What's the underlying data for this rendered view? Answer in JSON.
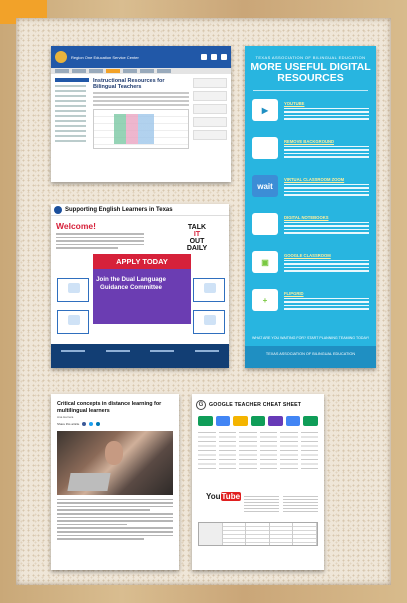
{
  "card_web": {
    "org_name": "Region One Education Service Center",
    "heading": "Instructional Resources for Bilingual Teachers"
  },
  "card_infographic": {
    "kicker": "TEXAS ASSOCIATION OF BILINGUAL EDUCATION",
    "title": "MORE USEFUL DIGITAL RESOURCES",
    "items": [
      {
        "label": "YOUTUBE",
        "icon": "youtube-icon",
        "icon_color": "#ffffff",
        "icon_text": "▶"
      },
      {
        "label": "REMOVE BACKGROUND",
        "icon": "remove-bg-icon",
        "icon_color": "#e9c7c7",
        "icon_text": ""
      },
      {
        "label": "VIRTUAL CLASSROOM ZOOM",
        "icon": "nearpod-icon",
        "icon_color": "#ffffff",
        "icon_text": "wait"
      },
      {
        "label": "DIGITAL NOTEBOOKS",
        "icon": "notebook-icon",
        "icon_color": "#ffffff",
        "icon_text": ""
      },
      {
        "label": "GOOGLE CLASSROOM",
        "icon": "classroom-icon",
        "icon_color": "#7bc943",
        "icon_text": "▣"
      },
      {
        "label": "FLIPGRID",
        "icon": "flipgrid-icon",
        "icon_color": "#7bc943",
        "icon_text": "+"
      }
    ],
    "footer_note": "WHAT ARE YOU WAITING FOR? START PLANNING TEAMING TODAY!",
    "footer": "TEXAS ASSOCIATION OF BILINGUAL EDUCATION"
  },
  "card_ell": {
    "title": "Supporting English Learners in Texas",
    "welcome": "Welcome!",
    "talk_line1": "TALK",
    "talk_line2": "IT",
    "talk_line3": "OUT",
    "talk_line4": "DAILY",
    "apply": "APPLY TODAY",
    "join": "Join the Dual Language Guidance Committee"
  },
  "card_article": {
    "title": "Critical concepts in distance learning for multilingual learners",
    "byline": "Ana Herrera",
    "share_label": "Share this article"
  },
  "card_google": {
    "title": "GOOGLE TEACHER CHEAT SHEET",
    "youtube_you": "You",
    "youtube_tube": "Tube",
    "app_colors": [
      "#0f9d58",
      "#4285f4",
      "#f4b400",
      "#0f9d58",
      "#673ab7",
      "#4285f4",
      "#0f9d58"
    ]
  },
  "colors": {
    "frame_wood": "#d9bd90",
    "cork": "#efe6d8",
    "corner_tab": "#f2a229",
    "infographic_bg": "#28b5e0"
  }
}
